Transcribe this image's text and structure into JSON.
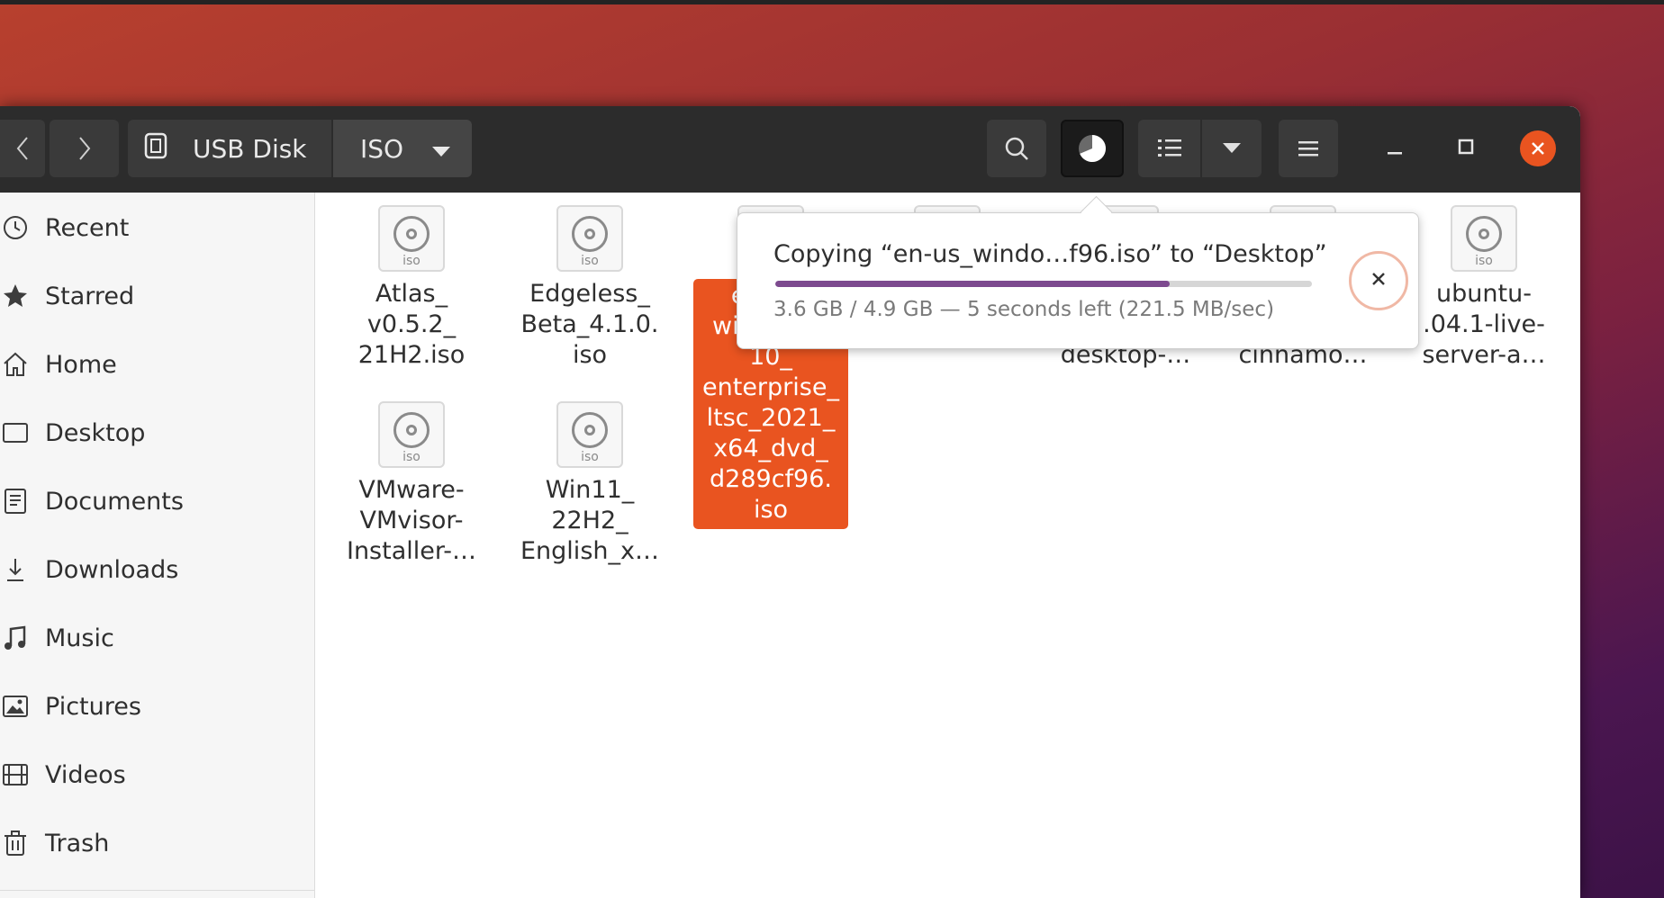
{
  "window": {
    "nav": {
      "back_icon": "chevron-left-icon",
      "forward_icon": "chevron-right-icon"
    },
    "pathbar": {
      "drive_icon": "usb-drive-icon",
      "drive_label": "USB Disk",
      "folder_label": "ISO",
      "folder_menu_icon": "chevron-down-icon"
    },
    "toolbar": {
      "search_icon": "search-icon",
      "operations_icon": "pie-progress-icon",
      "list_view_icon": "list-view-icon",
      "view_menu_icon": "chevron-down-icon",
      "main_menu_icon": "hamburger-icon"
    },
    "controls": {
      "minimize_icon": "minimize-icon",
      "maximize_icon": "maximize-icon",
      "close_icon": "close-icon",
      "close_color": "#e95420"
    }
  },
  "sidebar": {
    "items": [
      {
        "label": "Recent",
        "icon": "clock-icon"
      },
      {
        "label": "Starred",
        "icon": "star-icon"
      },
      {
        "label": "Home",
        "icon": "home-icon"
      },
      {
        "label": "Desktop",
        "icon": "desktop-icon"
      },
      {
        "label": "Documents",
        "icon": "document-icon"
      },
      {
        "label": "Downloads",
        "icon": "download-icon"
      },
      {
        "label": "Music",
        "icon": "music-icon"
      },
      {
        "label": "Pictures",
        "icon": "picture-icon"
      },
      {
        "label": "Videos",
        "icon": "video-icon"
      },
      {
        "label": "Trash",
        "icon": "trash-icon"
      }
    ]
  },
  "files": [
    {
      "name": "Atlas_\nv0.5.2_\n21H2.iso",
      "ext": "iso"
    },
    {
      "name": "Edgeless_\nBeta_4.1.0.\niso",
      "ext": "iso"
    },
    {
      "name": "en-us_\nwindows_\n10_\nenterprise_\nltsc_2021_\nx64_dvd_\nd289cf96.\niso",
      "ext": "iso",
      "selected": true
    },
    {
      "name": "",
      "ext": "iso"
    },
    {
      "name": "desktop-…",
      "ext": "iso"
    },
    {
      "name": "cinnamo…",
      "ext": "iso"
    },
    {
      "name": "ubuntu-\n.04.1-live-\nserver-a…",
      "ext": "iso"
    },
    {
      "name": "VMware-\nVMvisor-\nInstaller-…",
      "ext": "iso"
    },
    {
      "name": "Win11_\n22H2_\nEnglish_x…",
      "ext": "iso"
    }
  ],
  "operation": {
    "title": "Copying “en-us_windo…f96.iso” to “Desktop”",
    "details": "3.6 GB / 4.9 GB — 5 seconds left (221.5 MB/sec)",
    "progress": 0.735,
    "progress_color": "#7d4a8f",
    "cancel_icon": "close-icon"
  },
  "colors": {
    "accent": "#e95420",
    "headerbar": "#2c2c2c"
  }
}
